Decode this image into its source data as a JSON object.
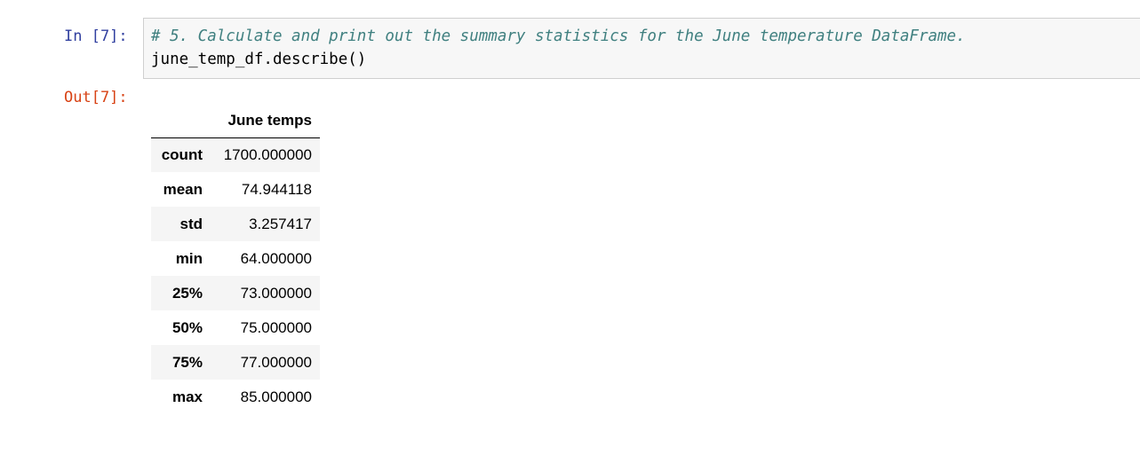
{
  "cell": {
    "in_prompt": "In [7]:",
    "out_prompt": "Out[7]:",
    "code_comment": "# 5. Calculate and print out the summary statistics for the June temperature DataFrame.",
    "code_line": "june_temp_df.describe()"
  },
  "table": {
    "column_header": "June temps",
    "rows": [
      {
        "label": "count",
        "value": "1700.000000"
      },
      {
        "label": "mean",
        "value": "74.944118"
      },
      {
        "label": "std",
        "value": "3.257417"
      },
      {
        "label": "min",
        "value": "64.000000"
      },
      {
        "label": "25%",
        "value": "73.000000"
      },
      {
        "label": "50%",
        "value": "75.000000"
      },
      {
        "label": "75%",
        "value": "77.000000"
      },
      {
        "label": "max",
        "value": "85.000000"
      }
    ]
  }
}
